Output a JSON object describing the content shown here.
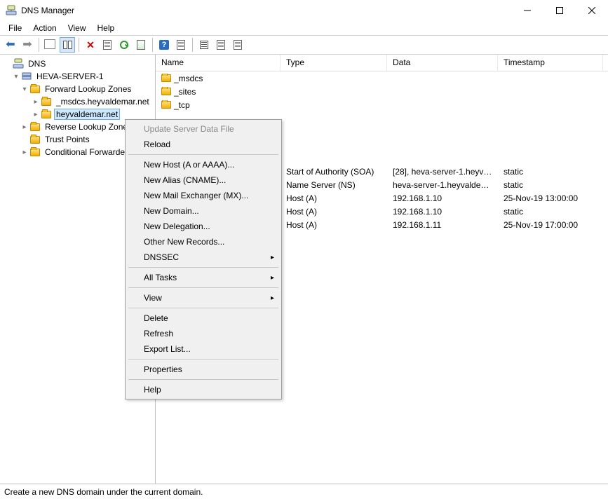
{
  "window": {
    "title": "DNS Manager"
  },
  "menu": {
    "file": "File",
    "action": "Action",
    "view": "View",
    "help": "Help"
  },
  "tree": {
    "root": "DNS",
    "server": "HEVA-SERVER-1",
    "flz": "Forward Lookup Zones",
    "zone_msdcs": "_msdcs.heyvaldemar.net",
    "zone_main": "heyvaldemar.net",
    "rlz": "Reverse Lookup Zones",
    "trust": "Trust Points",
    "cond": "Conditional Forwarders"
  },
  "columns": {
    "name": "Name",
    "type": "Type",
    "data": "Data",
    "timestamp": "Timestamp"
  },
  "rows": [
    {
      "name": "_msdcs",
      "type": "",
      "data": "",
      "ts": ""
    },
    {
      "name": "_sites",
      "type": "",
      "data": "",
      "ts": ""
    },
    {
      "name": "_tcp",
      "type": "",
      "data": "",
      "ts": ""
    },
    {
      "name": "",
      "type": "Start of Authority (SOA)",
      "data": "[28], heva-server-1.heyval...",
      "ts": "static"
    },
    {
      "name": "",
      "type": "Name Server (NS)",
      "data": "heva-server-1.heyvaldema...",
      "ts": "static"
    },
    {
      "name": "",
      "type": "Host (A)",
      "data": "192.168.1.10",
      "ts": "25-Nov-19 13:00:00"
    },
    {
      "name": "",
      "type": "Host (A)",
      "data": "192.168.1.10",
      "ts": "static"
    },
    {
      "name": "",
      "type": "Host (A)",
      "data": "192.168.1.11",
      "ts": "25-Nov-19 17:00:00"
    }
  ],
  "context": {
    "update": "Update Server Data File",
    "reload": "Reload",
    "newhost": "New Host (A or AAAA)...",
    "newalias": "New Alias (CNAME)...",
    "newmx": "New Mail Exchanger (MX)...",
    "newdomain": "New Domain...",
    "newdeleg": "New Delegation...",
    "other": "Other New Records...",
    "dnssec": "DNSSEC",
    "alltasks": "All Tasks",
    "view": "View",
    "delete": "Delete",
    "refresh": "Refresh",
    "export": "Export List...",
    "properties": "Properties",
    "help": "Help"
  },
  "status": "Create a new DNS domain under the current domain."
}
